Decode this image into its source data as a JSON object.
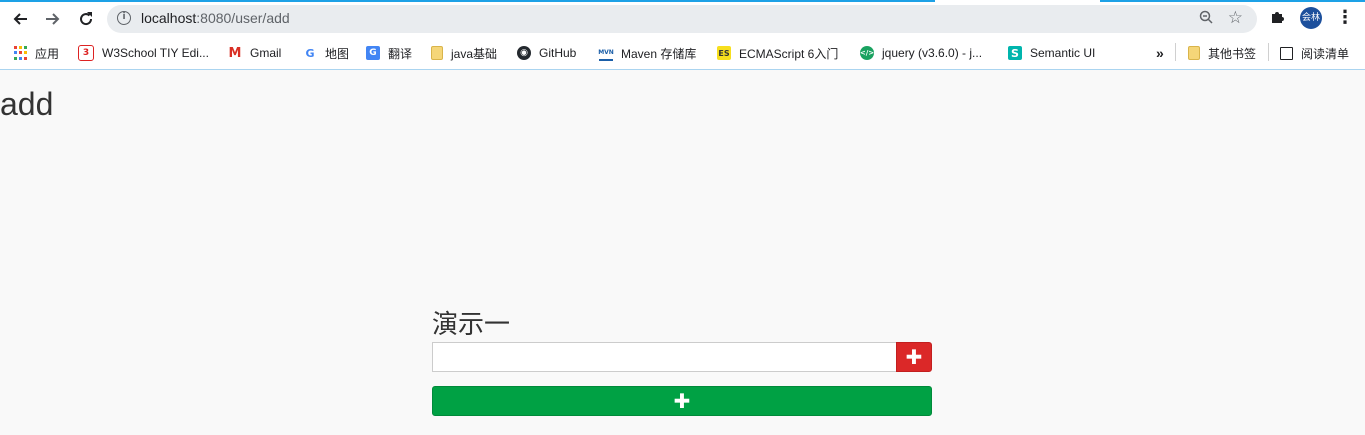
{
  "browser": {
    "url_host": "localhost",
    "url_path": ":8080/user/add",
    "back_icon": "arrow-left-icon",
    "forward_icon": "arrow-right-icon",
    "reload_icon": "reload-icon",
    "avatar_label": "会林",
    "accent_color": "#1da1e6"
  },
  "bookmarks": {
    "items": [
      {
        "label": "应用",
        "icon": "apps-grid-icon"
      },
      {
        "label": "W3School TIY Edi...",
        "icon": "w3school-icon"
      },
      {
        "label": "Gmail",
        "icon": "gmail-icon"
      },
      {
        "label": "地图",
        "icon": "google-icon"
      },
      {
        "label": "翻译",
        "icon": "translate-icon"
      },
      {
        "label": "java基础",
        "icon": "folder-icon"
      },
      {
        "label": "GitHub",
        "icon": "github-icon"
      },
      {
        "label": "Maven 存储库",
        "icon": "maven-icon"
      },
      {
        "label": "ECMAScript 6入门",
        "icon": "es-icon"
      },
      {
        "label": "jquery (v3.6.0) - j...",
        "icon": "jquery-icon"
      },
      {
        "label": "Semantic UI",
        "icon": "semantic-icon"
      }
    ],
    "overflow_label": "»",
    "other_bookmarks": "其他书签",
    "reading_list": "阅读清单"
  },
  "page": {
    "heading": "add",
    "demo_title": "演示一",
    "input_value": "",
    "add_button_symbol": "✚",
    "wide_button_symbol": "✚",
    "add_button_color": "#db2828",
    "wide_button_color": "#00a144"
  }
}
